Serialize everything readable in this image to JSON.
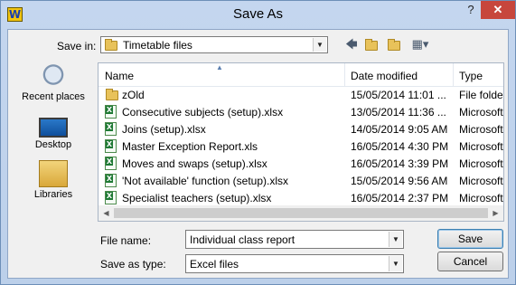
{
  "window": {
    "title": "Save As",
    "help_label": "?",
    "close_label": "✕"
  },
  "toolbar": {
    "save_in_label": "Save in:",
    "save_in_value": "Timetable files",
    "icons": [
      "back-arrow-icon",
      "up-folder-icon",
      "new-folder-icon",
      "views-menu-icon"
    ]
  },
  "places": [
    {
      "label": "Recent places",
      "icon": "recent-places-icon"
    },
    {
      "label": "Desktop",
      "icon": "desktop-icon"
    },
    {
      "label": "Libraries",
      "icon": "libraries-icon"
    }
  ],
  "columns": {
    "name": "Name",
    "date": "Date modified",
    "type": "Type"
  },
  "files": [
    {
      "name": "zOld",
      "date": "15/05/2014 11:01 ...",
      "type": "File folder",
      "icon": "folder-icon"
    },
    {
      "name": "Consecutive subjects (setup).xlsx",
      "date": "13/05/2014 11:36 ...",
      "type": "Microsoft",
      "icon": "excel-file-icon"
    },
    {
      "name": "Joins (setup).xlsx",
      "date": "14/05/2014 9:05 AM",
      "type": "Microsoft",
      "icon": "excel-file-icon"
    },
    {
      "name": "Master Exception Report.xls",
      "date": "16/05/2014 4:30 PM",
      "type": "Microsoft",
      "icon": "excel-file-icon"
    },
    {
      "name": "Moves and swaps (setup).xlsx",
      "date": "16/05/2014 3:39 PM",
      "type": "Microsoft",
      "icon": "excel-file-icon"
    },
    {
      "name": "'Not available' function (setup).xlsx",
      "date": "15/05/2014 9:56 AM",
      "type": "Microsoft",
      "icon": "excel-file-icon"
    },
    {
      "name": "Specialist teachers (setup).xlsx",
      "date": "16/05/2014 2:37 PM",
      "type": "Microsoft",
      "icon": "excel-file-icon"
    }
  ],
  "form": {
    "file_name_label": "File name:",
    "file_name_value": "Individual class report",
    "save_type_label": "Save as type:",
    "save_type_value": "Excel files"
  },
  "buttons": {
    "save": "Save",
    "cancel": "Cancel"
  },
  "colors": {
    "close": "#c7463c",
    "frame": "#c4d6ef",
    "excel_green": "#1f7a35",
    "folder": "#e8c25a"
  }
}
